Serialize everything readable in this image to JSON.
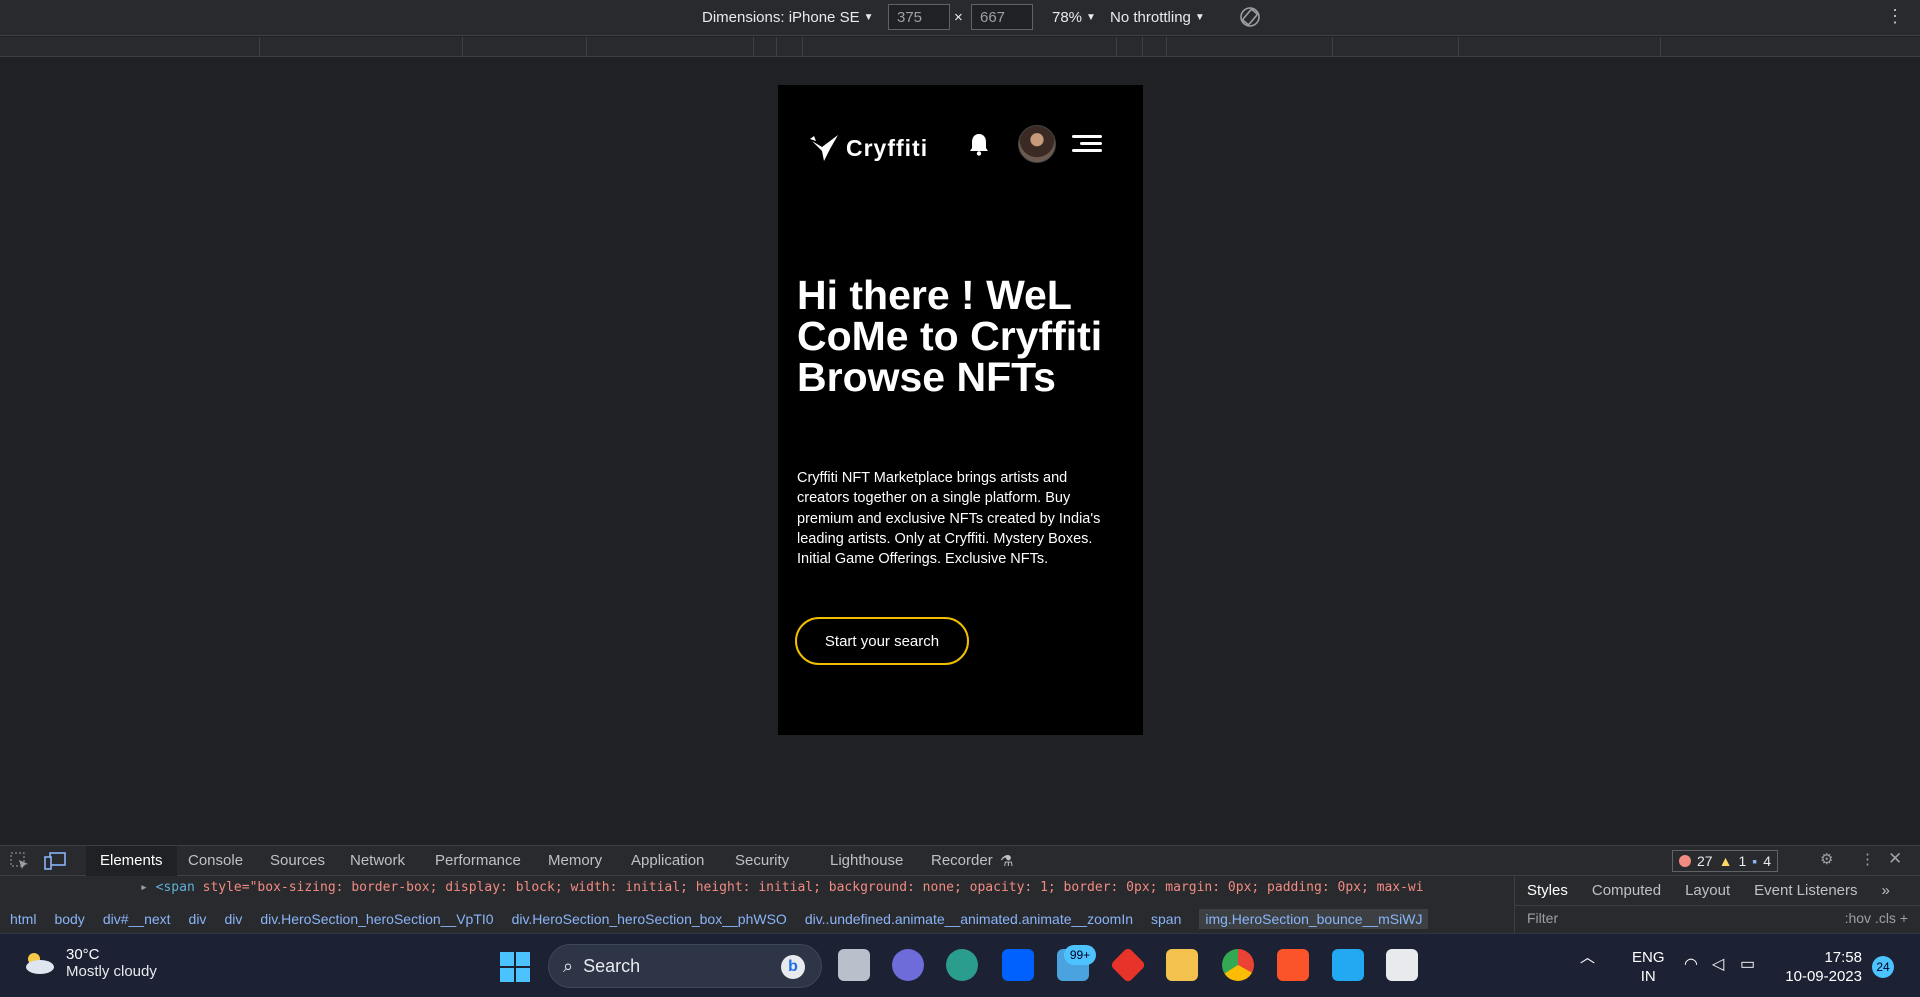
{
  "devtools_toolbar": {
    "dimensions_label": "Dimensions: iPhone SE",
    "width_value": "375",
    "height_value": "667",
    "times": "×",
    "zoom": "78%",
    "throttling": "No throttling"
  },
  "site": {
    "logo_text": "Cryffiti",
    "hero_title": "Hi there ! WeL CoMe to Cryffiti Browse NFTs",
    "hero_description": "Cryffiti NFT Marketplace brings artists and creators together on a single platform. Buy premium and exclusive NFTs created by India's leading artists. Only at Cryffiti. Mystery Boxes. Initial Game Offerings. Exclusive NFTs.",
    "cta_label": "Start your search"
  },
  "devtools": {
    "tabs": [
      "Elements",
      "Console",
      "Sources",
      "Network",
      "Performance",
      "Memory",
      "Application",
      "Security",
      "Lighthouse",
      "Recorder"
    ],
    "active_tab": "Elements",
    "errors": "27",
    "warnings": "1",
    "messages": "4",
    "code_line_tag": "<span",
    "code_line_attrs": " style=\"box-sizing: border-box; display: block; width: initial; height: initial; background: none; opacity: 1; border: 0px; margin: 0px; padding: 0px; max-wi",
    "breadcrumbs": [
      "html",
      "body",
      "div#__next",
      "div",
      "div",
      "div.HeroSection_heroSection__VpTI0",
      "div.HeroSection_heroSection_box__phWSO",
      "div..undefined.animate__animated.animate__zoomIn",
      "span",
      "img.HeroSection_bounce__mSiWJ"
    ],
    "side_tabs": [
      "Styles",
      "Computed",
      "Layout",
      "Event Listeners"
    ],
    "side_active": "Styles",
    "filter_placeholder": "Filter",
    "filter_tools": ":hov  .cls  +"
  },
  "taskbar": {
    "temperature": "30°C",
    "weather": "Mostly cloudy",
    "search_label": "Search",
    "mail_badge": "99+",
    "lang_top": "ENG",
    "lang_bottom": "IN",
    "time": "17:58",
    "date": "10-09-2023",
    "notifications": "24"
  },
  "colors": {
    "accent_yellow": "#f0c000",
    "windows_blue": "#4cc2ff"
  }
}
